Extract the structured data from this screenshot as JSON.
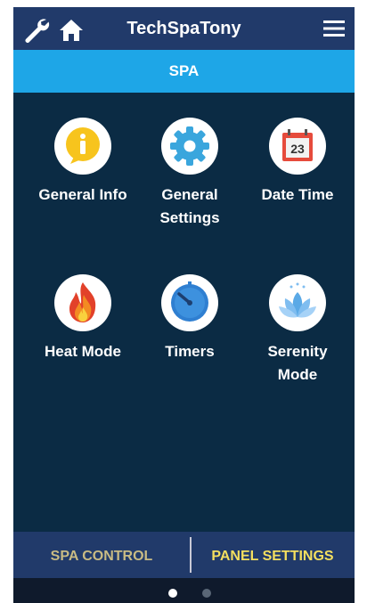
{
  "header": {
    "title": "TechSpaTony",
    "left_icons": [
      "wrench-icon",
      "home-icon"
    ],
    "right_icon": "hamburger-menu-icon"
  },
  "section": {
    "label": "SPA"
  },
  "tiles": [
    {
      "label_line1": "General Info",
      "label_line2": "",
      "icon": "info-icon"
    },
    {
      "label_line1": "General",
      "label_line2": "Settings",
      "icon": "gear-icon"
    },
    {
      "label_line1": "Date Time",
      "label_line2": "",
      "icon": "calendar-icon",
      "icon_text": "23"
    },
    {
      "label_line1": "Heat Mode",
      "label_line2": "",
      "icon": "flame-icon"
    },
    {
      "label_line1": "Timers",
      "label_line2": "",
      "icon": "timer-icon"
    },
    {
      "label_line1": "Serenity",
      "label_line2": "Mode",
      "icon": "lotus-icon"
    }
  ],
  "bottom_tabs": {
    "left": "SPA CONTROL",
    "right": "PANEL SETTINGS"
  },
  "pager": {
    "pages": 2,
    "current": 1
  },
  "colors": {
    "background": "#0b2b44",
    "header": "#213a6a",
    "section_bar": "#1ea6e7",
    "tab_active": "#f4df5f",
    "tab_inactive": "#c9bb84"
  }
}
